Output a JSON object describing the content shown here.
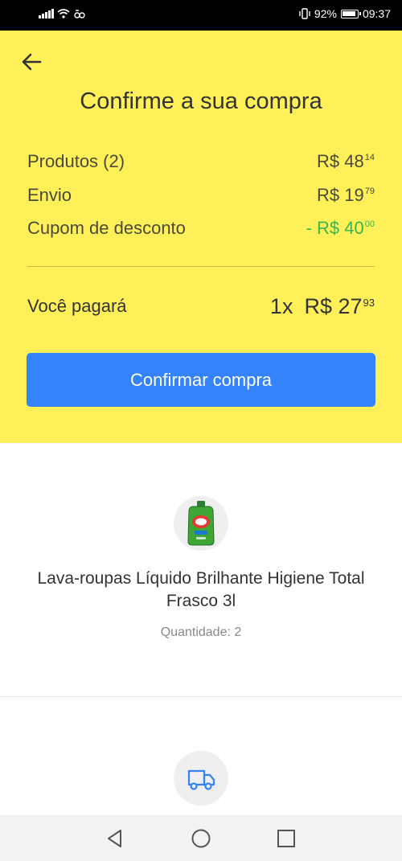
{
  "status_bar": {
    "battery": "92%",
    "battery_level": 0.92,
    "time": "09:37"
  },
  "header": {
    "title": "Confirme a sua compra",
    "back_icon": "arrow-left-icon"
  },
  "summary": {
    "products": {
      "label": "Produtos (2)",
      "currency": "R$",
      "whole": "48",
      "cents": "14"
    },
    "shipping": {
      "label": "Envio",
      "currency": "R$",
      "whole": "19",
      "cents": "79"
    },
    "coupon": {
      "label": "Cupom de desconto",
      "currency": "- R$",
      "whole": "40",
      "cents": "00",
      "color": "#39b54a"
    }
  },
  "total": {
    "label": "Você pagará",
    "installments": "1x",
    "currency": "R$",
    "whole": "27",
    "cents": "93"
  },
  "confirm_button": {
    "label": "Confirmar compra",
    "color": "#3483fa"
  },
  "product": {
    "name": "Lava-roupas Líquido Brilhante Higiene Total Frasco 3l",
    "quantity": "Quantidade: 2"
  },
  "shipping_section": {
    "icon": "truck-icon"
  },
  "colors": {
    "header_bg": "#fff059",
    "accent": "#3483fa"
  }
}
